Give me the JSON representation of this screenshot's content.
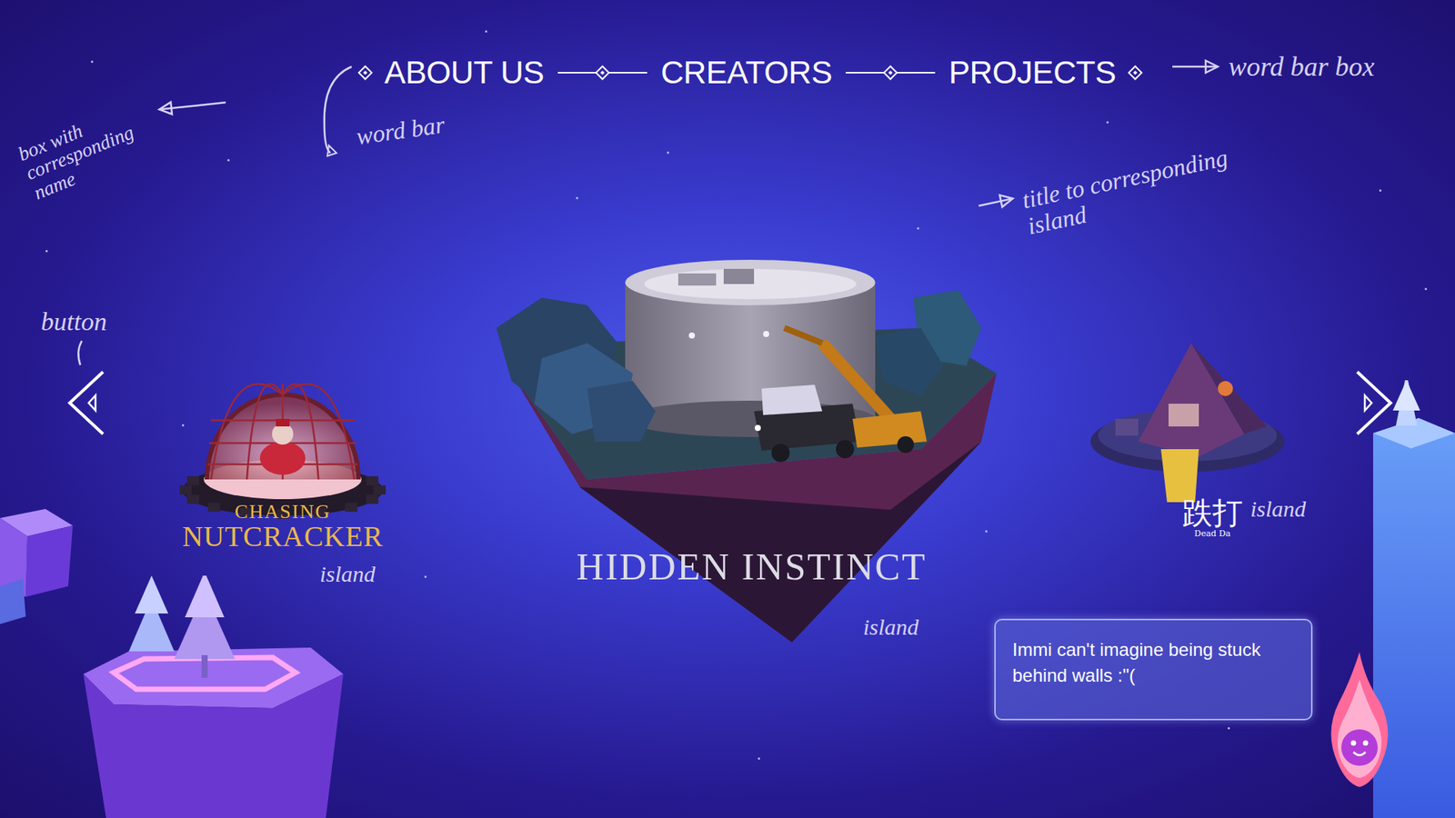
{
  "nav": {
    "items": [
      {
        "label": "ABOUT US"
      },
      {
        "label": "CREATORS"
      },
      {
        "label": "PROJECTS"
      }
    ]
  },
  "islands": [
    {
      "title": "CHASING",
      "subtitle": "NUTCRACKER",
      "note": "island",
      "kind": "dome",
      "selected": false
    },
    {
      "title": "HIDDEN INSTINCT",
      "subtitle": "",
      "note": "island",
      "kind": "hangar",
      "selected": true
    },
    {
      "title": "跌打",
      "subtitle": "Dead Da",
      "note": "island",
      "kind": "tent",
      "selected": false
    }
  ],
  "speech_bubble": {
    "text": "Immi can't imagine being stuck behind walls :\"("
  },
  "annotations": [
    {
      "text": "word bar box"
    },
    {
      "text": "word bar"
    },
    {
      "text": "box with corresponding name"
    },
    {
      "text": "title to corresponding island"
    },
    {
      "text": "button"
    }
  ]
}
